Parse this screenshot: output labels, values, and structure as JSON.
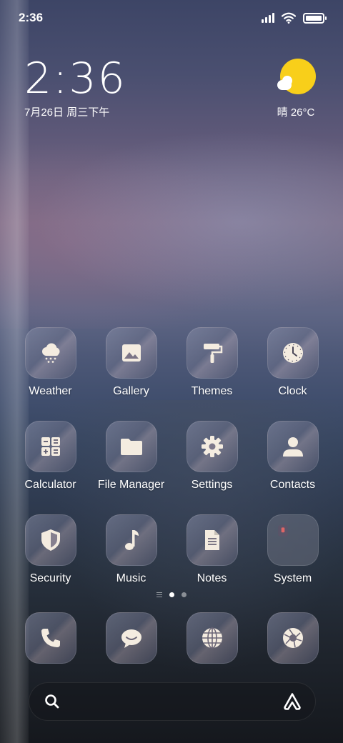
{
  "status_bar": {
    "time": "2:36",
    "icons": [
      "signal-icon",
      "wifi-icon",
      "battery-icon"
    ]
  },
  "clock_widget": {
    "time": "2:36",
    "date": "7月26日 周三下午"
  },
  "weather_widget": {
    "icon": "sun-cloud-icon",
    "text": "晴 26°C"
  },
  "apps": [
    {
      "label": "Weather",
      "icon": "weather-snow-cloud-icon"
    },
    {
      "label": "Gallery",
      "icon": "gallery-picture-icon"
    },
    {
      "label": "Themes",
      "icon": "paint-roller-icon"
    },
    {
      "label": "Clock",
      "icon": "clock-icon"
    },
    {
      "label": "Calculator",
      "icon": "calculator-icon"
    },
    {
      "label": "File Manager",
      "icon": "folder-icon"
    },
    {
      "label": "Settings",
      "icon": "gear-icon"
    },
    {
      "label": "Contacts",
      "icon": "person-icon"
    },
    {
      "label": "Security",
      "icon": "shield-icon"
    },
    {
      "label": "Music",
      "icon": "music-note-icon"
    },
    {
      "label": "Notes",
      "icon": "document-icon"
    },
    {
      "label": "System",
      "icon": "folder-icon"
    }
  ],
  "page_indicator": {
    "current": 1,
    "total": 2
  },
  "dock": [
    {
      "icon": "phone-icon"
    },
    {
      "icon": "message-bubble-icon"
    },
    {
      "icon": "globe-icon"
    },
    {
      "icon": "camera-shutter-icon"
    }
  ],
  "search_bar": {
    "left_icon": "search-icon",
    "right_icon": "assistant-icon"
  },
  "colors": {
    "sun": "#f8cf1a",
    "icon_glyph": "#f4ece0"
  }
}
